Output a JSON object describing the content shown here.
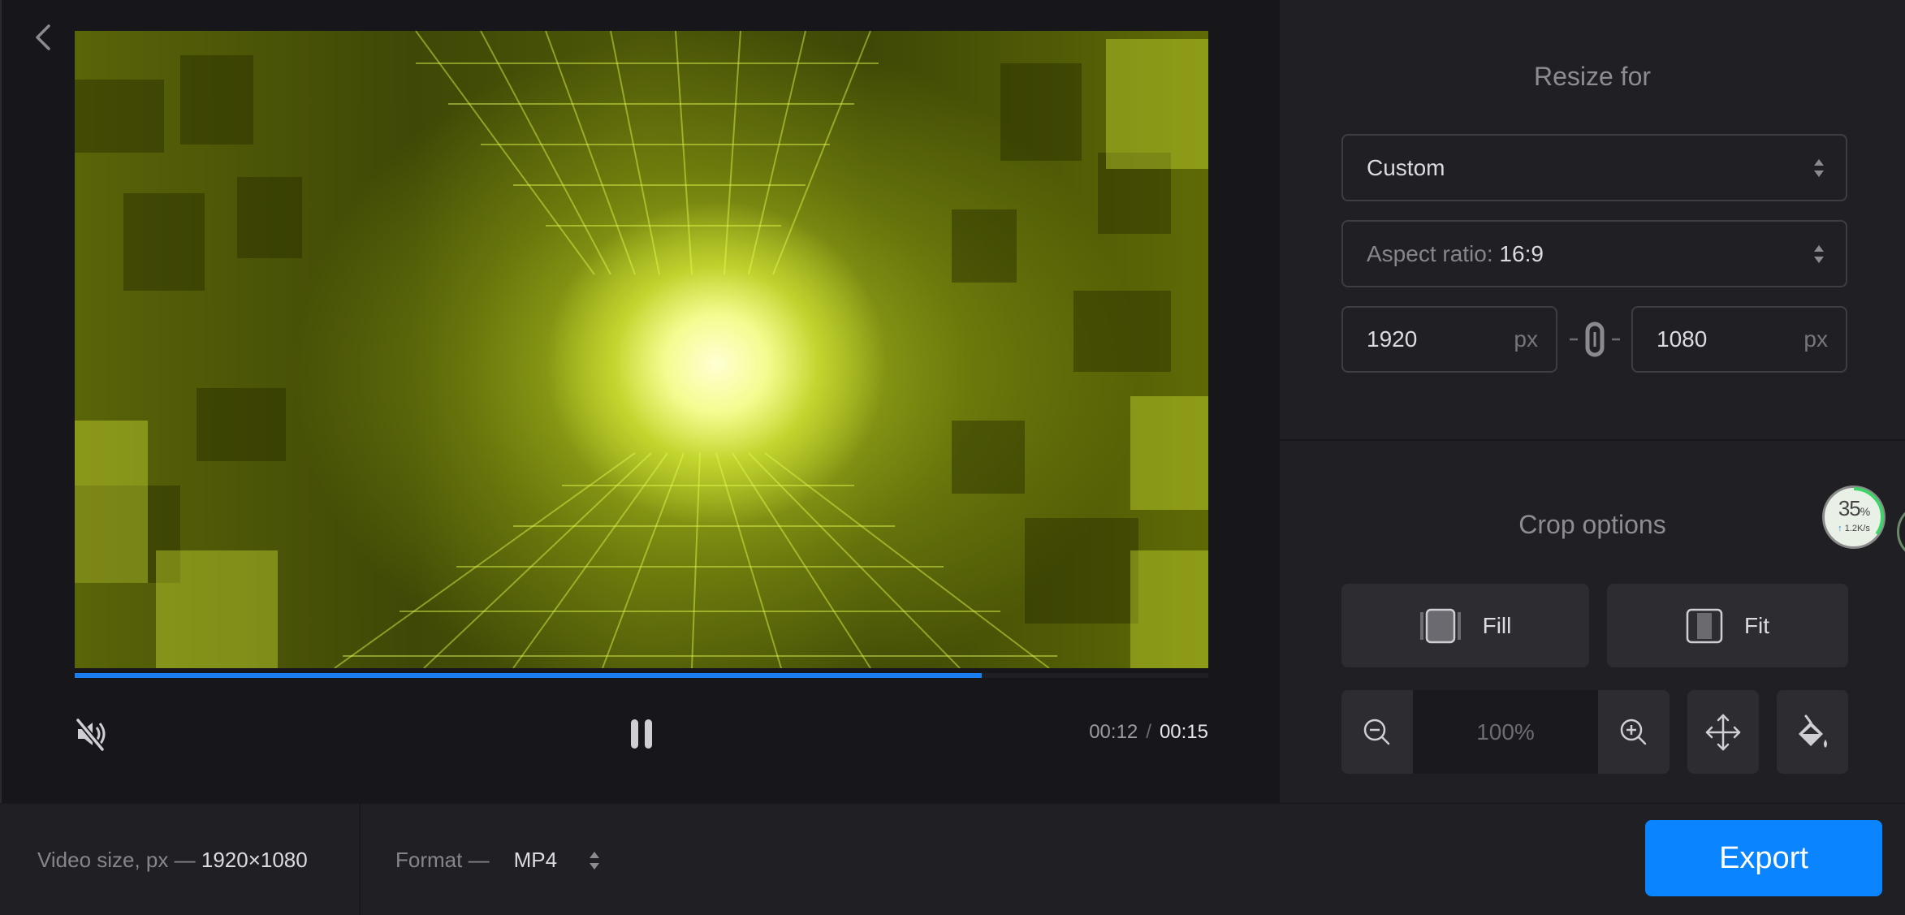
{
  "player": {
    "back_icon": "chevron-left-icon",
    "mute_icon": "volume-muted-icon",
    "pause_icon": "pause-icon",
    "current_time": "00:12",
    "separator": "/",
    "total_time": "00:15",
    "progress_fraction": 0.8
  },
  "resize": {
    "title": "Resize for",
    "preset_value": "Custom",
    "aspect_label": "Aspect ratio:",
    "aspect_value": "16:9",
    "width_value": "1920",
    "height_value": "1080",
    "unit": "px",
    "link_icon": "chain-link-icon"
  },
  "crop": {
    "title": "Crop options",
    "fill_label": "Fill",
    "fit_label": "Fit",
    "zoom_value": "100%",
    "zoom_out_icon": "zoom-out-icon",
    "zoom_in_icon": "zoom-in-icon",
    "move_icon": "move-arrows-icon",
    "paint_icon": "paint-bucket-icon"
  },
  "speed_widget": {
    "percent": "35",
    "percent_sign": "%",
    "rate": "1.2K/s",
    "progress_fraction": 0.35
  },
  "bottom": {
    "video_size_label": "Video size, px —",
    "video_size_value": "1920×1080",
    "format_label": "Format —",
    "format_value": "MP4",
    "export_label": "Export"
  },
  "colors": {
    "accent": "#0a84ff",
    "progress": "#1a7ef0",
    "panel_bg": "#202024",
    "preview_bg": "#17171b"
  }
}
